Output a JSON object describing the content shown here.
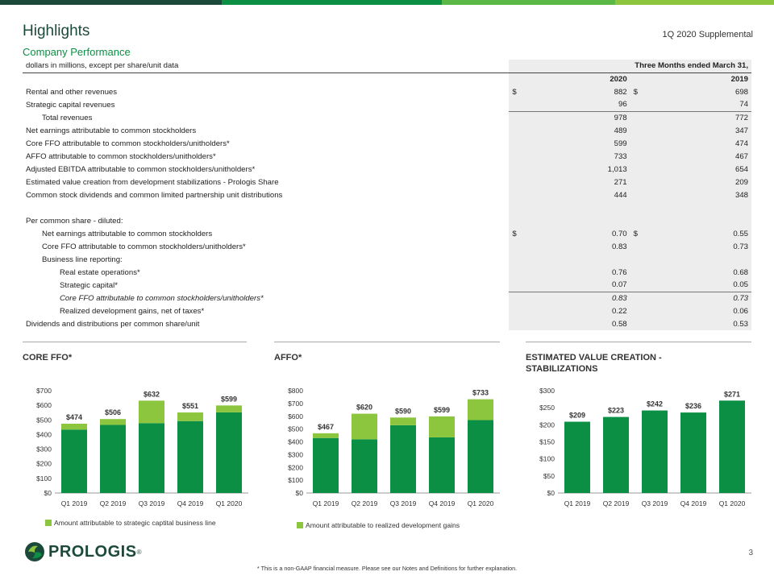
{
  "header": {
    "title": "Highlights",
    "supplemental": "1Q 2020 Supplemental",
    "subtitle": "Company Performance",
    "colors": {
      "dark": "#1c4a3a",
      "green": "#0b8f44",
      "lightgreen": "#8cc63f"
    }
  },
  "table": {
    "units_label": "dollars in millions, except per share/unit data",
    "period_header": "Three Months ended March 31,",
    "col_2020": "2020",
    "col_2019": "2019",
    "rows": [
      {
        "label": "Rental and other revenues",
        "v2020": "882",
        "v2019": "698",
        "d2020": "$",
        "d2019": "$"
      },
      {
        "label": "Strategic capital revenues",
        "v2020": "96",
        "v2019": "74"
      },
      {
        "label": "Total revenues",
        "v2020": "978",
        "v2019": "772"
      },
      {
        "label": "Net earnings attributable to common stockholders",
        "v2020": "489",
        "v2019": "347"
      },
      {
        "label": "Core FFO attributable to common stockholders/unitholders*",
        "v2020": "599",
        "v2019": "474"
      },
      {
        "label": "AFFO attributable to common stockholders/unitholders*",
        "v2020": "733",
        "v2019": "467"
      },
      {
        "label": "Adjusted EBITDA attributable to common stockholders/unitholders*",
        "v2020": "1,013",
        "v2019": "654"
      },
      {
        "label": "Estimated value creation from development stabilizations - Prologis Share",
        "v2020": "271",
        "v2019": "209"
      },
      {
        "label": "Common stock dividends and common limited partnership unit distributions",
        "v2020": "444",
        "v2019": "348"
      },
      {
        "label": "Per common share - diluted:"
      },
      {
        "label": "Net earnings attributable to common stockholders",
        "v2020": "0.70",
        "v2019": "0.55",
        "d2020": "$",
        "d2019": "$"
      },
      {
        "label": "Core FFO attributable to common stockholders/unitholders*",
        "v2020": "0.83",
        "v2019": "0.73"
      },
      {
        "label": "Business line reporting:"
      },
      {
        "label": "Real estate operations*",
        "v2020": "0.76",
        "v2019": "0.68"
      },
      {
        "label": "Strategic capital*",
        "v2020": "0.07",
        "v2019": "0.05"
      },
      {
        "label": "Core FFO attributable to common stockholders/unitholders*",
        "v2020": "0.83",
        "v2019": "0.73"
      },
      {
        "label": "Realized development gains, net of taxes*",
        "v2020": "0.22",
        "v2019": "0.06"
      },
      {
        "label": "Dividends and distributions per common share/unit",
        "v2020": "0.58",
        "v2019": "0.53"
      }
    ]
  },
  "charts": {
    "core_ffo_title": "CORE FFO*",
    "affo_title": "AFFO*",
    "evc_title": "ESTIMATED VALUE CREATION - STABILIZATIONS",
    "core_ffo_legend": "Amount attributable to strategic captital business line",
    "affo_legend": "Amount attributable to realized development gains"
  },
  "chart_data": [
    {
      "type": "bar",
      "title": "CORE FFO*",
      "categories": [
        "Q1 2019",
        "Q2 2019",
        "Q3 2019",
        "Q4 2019",
        "Q1 2020"
      ],
      "ylim": [
        0,
        700
      ],
      "yticks": [
        0,
        100,
        200,
        300,
        400,
        500,
        600,
        700
      ],
      "ytick_labels": [
        "$0",
        "$100",
        "$200",
        "$300",
        "$400",
        "$500",
        "$600",
        "$700"
      ],
      "totals": [
        474,
        506,
        632,
        551,
        599
      ],
      "total_labels": [
        "$474",
        "$506",
        "$632",
        "$551",
        "$599"
      ],
      "series": [
        {
          "values": [
            434,
            466,
            478,
            492,
            552
          ],
          "color": "#0b8f44"
        },
        {
          "name": "Amount attributable to strategic captital business line",
          "values": [
            40,
            40,
            154,
            59,
            47
          ],
          "color": "#8cc63f"
        }
      ],
      "legend_position": "bottom-left",
      "grid": false
    },
    {
      "type": "bar",
      "title": "AFFO*",
      "categories": [
        "Q1 2019",
        "Q2 2019",
        "Q3 2019",
        "Q4 2019",
        "Q1 2020"
      ],
      "ylim": [
        0,
        800
      ],
      "yticks": [
        0,
        100,
        200,
        300,
        400,
        500,
        600,
        700,
        800
      ],
      "ytick_labels": [
        "$0",
        "$100",
        "$200",
        "$300",
        "$400",
        "$500",
        "$600",
        "$700",
        "$800"
      ],
      "totals": [
        467,
        620,
        590,
        599,
        733
      ],
      "total_labels": [
        "$467",
        "$620",
        "$590",
        "$599",
        "$733"
      ],
      "series": [
        {
          "values": [
            430,
            420,
            530,
            435,
            570
          ],
          "color": "#0b8f44"
        },
        {
          "name": "Amount attributable to realized development gains",
          "values": [
            37,
            200,
            60,
            164,
            163
          ],
          "color": "#8cc63f"
        }
      ],
      "legend_position": "bottom-left",
      "grid": false
    },
    {
      "type": "bar",
      "title": "ESTIMATED VALUE CREATION - STABILIZATIONS",
      "categories": [
        "Q1 2019",
        "Q2 2019",
        "Q3 2019",
        "Q4 2019",
        "Q1 2020"
      ],
      "ylim": [
        0,
        300
      ],
      "yticks": [
        0,
        50,
        100,
        150,
        200,
        250,
        300
      ],
      "ytick_labels": [
        "$0",
        "$50",
        "$100",
        "$150",
        "$200",
        "$250",
        "$300"
      ],
      "totals": [
        209,
        223,
        242,
        236,
        271
      ],
      "total_labels": [
        "$209",
        "$223",
        "$242",
        "$236",
        "$271"
      ],
      "series": [
        {
          "values": [
            209,
            223,
            242,
            236,
            271
          ],
          "color": "#0b8f44"
        }
      ],
      "grid": false
    }
  ],
  "footer": {
    "logo_text": "PROLOGIS",
    "logo_reg": "®",
    "logo_icon": "prologis-logo-icon",
    "footnote": "* This is a non-GAAP financial measure.  Please see our Notes and Definitions for further explanation.",
    "page_number": "3"
  }
}
